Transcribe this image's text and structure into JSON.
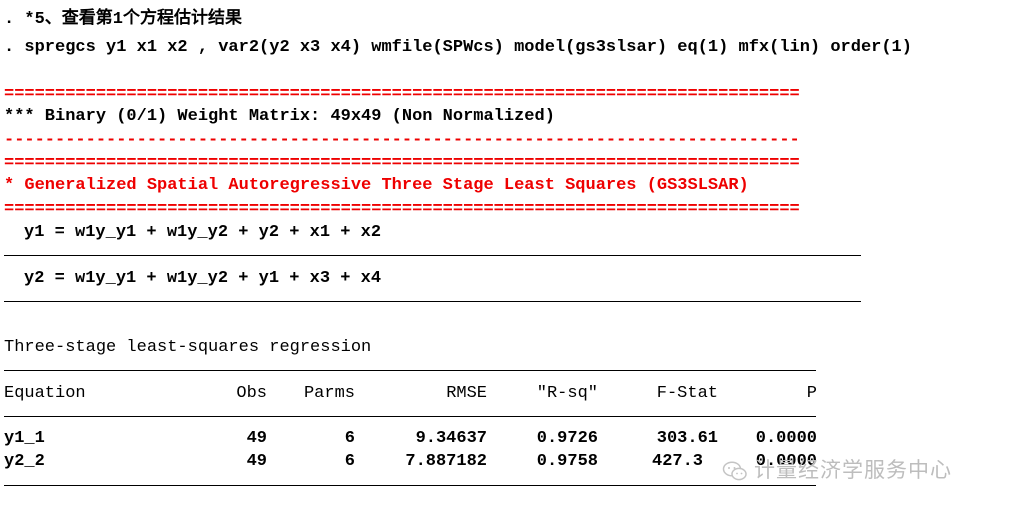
{
  "header": {
    "comment_line": ". *5、查看第1个方程估计结果",
    "command_line": ". spregcs y1 x1 x2 , var2(y2 x3 x4) wmfile(SPWcs) model(gs3slsar) eq(1) mfx(lin) order(1)"
  },
  "rules": {
    "double": "==============================================================================",
    "dashed": "------------------------------------------------------------------------------"
  },
  "weight_matrix": {
    "line": "*** Binary (0/1) Weight Matrix: 49x49 (Non Normalized)"
  },
  "model": {
    "title": "* Generalized Spatial Autoregressive Three Stage Least Squares (GS3SLSAR)",
    "equations": [
      "y1 = w1y_y1 + w1y_y2 + y2 + x1 + x2",
      "y2 = w1y_y1 + w1y_y2 + y1 + x3 + x4"
    ]
  },
  "regression": {
    "title": "Three-stage least-squares regression",
    "columns": [
      "Equation",
      "Obs",
      "Parms",
      "RMSE",
      "\"R-sq\"",
      "F-Stat",
      "P"
    ],
    "rows": [
      [
        "y1_1",
        "49",
        "6",
        "9.34637",
        "0.9726",
        "303.61",
        "0.0000"
      ],
      [
        "y2_2",
        "49",
        "6",
        "7.887182",
        "0.9758",
        "427.3",
        "0.0000"
      ]
    ]
  },
  "watermark": {
    "text": "计量经济学服务中心",
    "icon": "wechat-icon"
  }
}
